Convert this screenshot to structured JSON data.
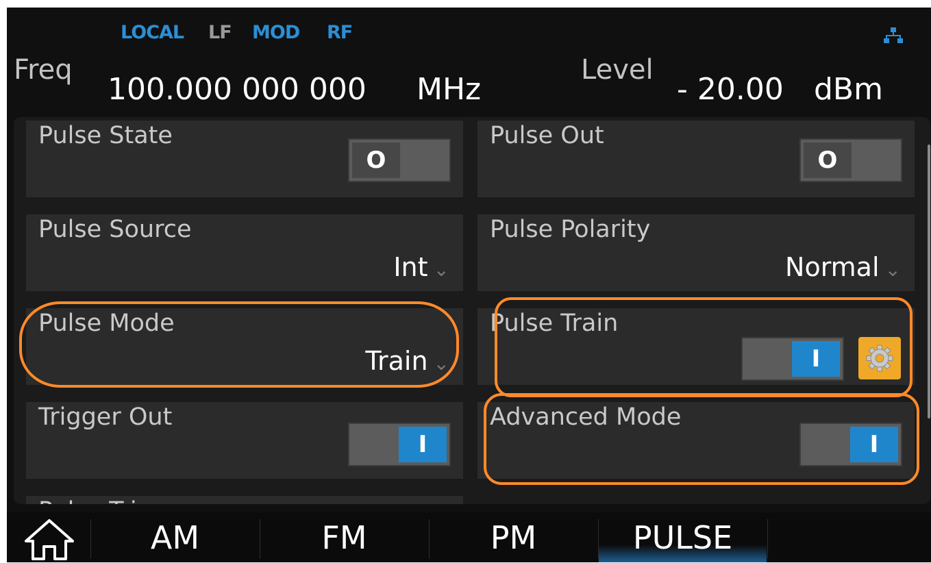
{
  "status": {
    "local": "LOCAL",
    "lf": "LF",
    "mod": "MOD",
    "rf": "RF",
    "network_icon": "network-icon",
    "colors": {
      "active": "#2b8fd6",
      "inactive": "#9a9a9a"
    }
  },
  "freq": {
    "label": "Freq",
    "value": "100.000 000 000",
    "unit": "MHz"
  },
  "level": {
    "label": "Level",
    "value": "- 20.00",
    "unit": "dBm"
  },
  "tiles": {
    "pulse_state": {
      "title": "Pulse State",
      "state": "O"
    },
    "pulse_out": {
      "title": "Pulse Out",
      "state": "O"
    },
    "pulse_source": {
      "title": "Pulse Source",
      "value": "Int"
    },
    "pulse_polarity": {
      "title": "Pulse Polarity",
      "value": "Normal"
    },
    "pulse_mode": {
      "title": "Pulse Mode",
      "value": "Train"
    },
    "pulse_train": {
      "title": "Pulse Train",
      "state": "I",
      "settings_icon": "gear-icon"
    },
    "trigger_out": {
      "title": "Trigger Out",
      "state": "I"
    },
    "advanced_mode": {
      "title": "Advanced Mode",
      "state": "I"
    },
    "pulse_trigger": {
      "title": "Pulse Trigger"
    }
  },
  "tabs": [
    {
      "label": "AM",
      "active": false
    },
    {
      "label": "FM",
      "active": false
    },
    {
      "label": "PM",
      "active": false
    },
    {
      "label": "PULSE",
      "active": true
    }
  ],
  "home_icon": "home-icon",
  "colors": {
    "toggle_on": "#1f86cc",
    "toggle_off": "#474747",
    "gear_button": "#f0a828",
    "highlight": "#ff8a2a"
  }
}
